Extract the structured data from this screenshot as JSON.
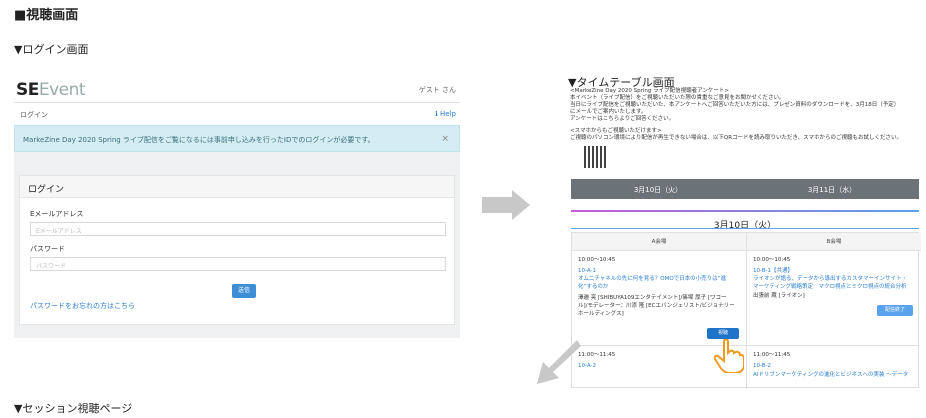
{
  "heading": "■視聴画面",
  "captions": {
    "login": "▼ログイン画面",
    "timetable": "▼タイムテーブル画面",
    "session": "▼セッション視聴ページ"
  },
  "login": {
    "logo_bold": "SE",
    "logo_rest": "Event",
    "guest": "ゲスト さん",
    "nav": "ログイン",
    "help": "ℹ Help",
    "alert": "MarkeZine Day 2020 Spring ライブ配信をご覧になるには事前申し込みを行ったIDでのログインが必要です。",
    "alert_close": "×",
    "panel_title": "ログイン",
    "email_label": "Eメールアドレス",
    "email_placeholder": "Eメールアドレス",
    "password_label": "パスワード",
    "password_placeholder": "パスワード",
    "submit": "送信",
    "forgot": "パスワードをお忘れの方はこちら"
  },
  "timetable": {
    "intro": [
      "<MarkeZine Day 2020 Spring ライブ配信視聴者アンケート>",
      "本イベント（ライブ配信）をご視聴いただいた際の貴重なご意見をお聞かせください。",
      "当日にライブ配信をご視聴いただいた、本アンケートへご回答いただいた方には、プレゼン資料のダウンロードを、3月18日（予定）",
      "にメールでご案内いたします。",
      "アンケートはこちらよりご回答ください。"
    ],
    "sp": [
      "<スマホからもご視聴いただけます>",
      "ご視聴のパソコン環境により配信が再生できない場合は、以下QRコードを読み取りいただき、スマホからのご視聴もお試しください。"
    ],
    "days": [
      "3月10日（火）",
      "3月11日（水）"
    ],
    "day_title": "3月10日（火）",
    "rooms": [
      "A会場",
      "B会場"
    ],
    "a1": {
      "time": "10:00〜10:45",
      "code": "10-A-1",
      "title": [
        "オムニチャネルの先に何を見る？OMOで日本の小売りは“進",
        "化”するのか"
      ],
      "speakers": [
        "澤邉 亮 [SHIBUYA109エンタテイメント]/篠塚 厚子 [ワコー",
        "ル]/モデレーター：川添 隆 [ECエバンジェリスト/ビジョナリー",
        "ホールディングス]"
      ],
      "button": "視聴"
    },
    "b1": {
      "time": "10:00〜10:45",
      "code": "10-B-1【共通】",
      "title": [
        "ライオンが語る、データから導出するカスタマーインサイト・",
        "マーケティング戦略策定　マクロ視点とミクロ視点の統合分析"
      ],
      "speakers": [
        "出張前 蔵 [ライオン]"
      ],
      "button": "配信終了"
    },
    "a2": {
      "time": "11:00〜11:45",
      "code": "10-A-2"
    },
    "b2": {
      "time": "11:00〜11:45",
      "code": "10-B-2",
      "title": "AIドリブンマーケティングの進化とビジネスへの実装 〜データ"
    }
  },
  "colors": {
    "accent": "#3e8ed6",
    "link": "#2a7ed1",
    "alert_bg": "#d4edf3",
    "daybar": "#6b7278",
    "arrow": "#c8c8c8",
    "hand": "#f29a1f"
  }
}
